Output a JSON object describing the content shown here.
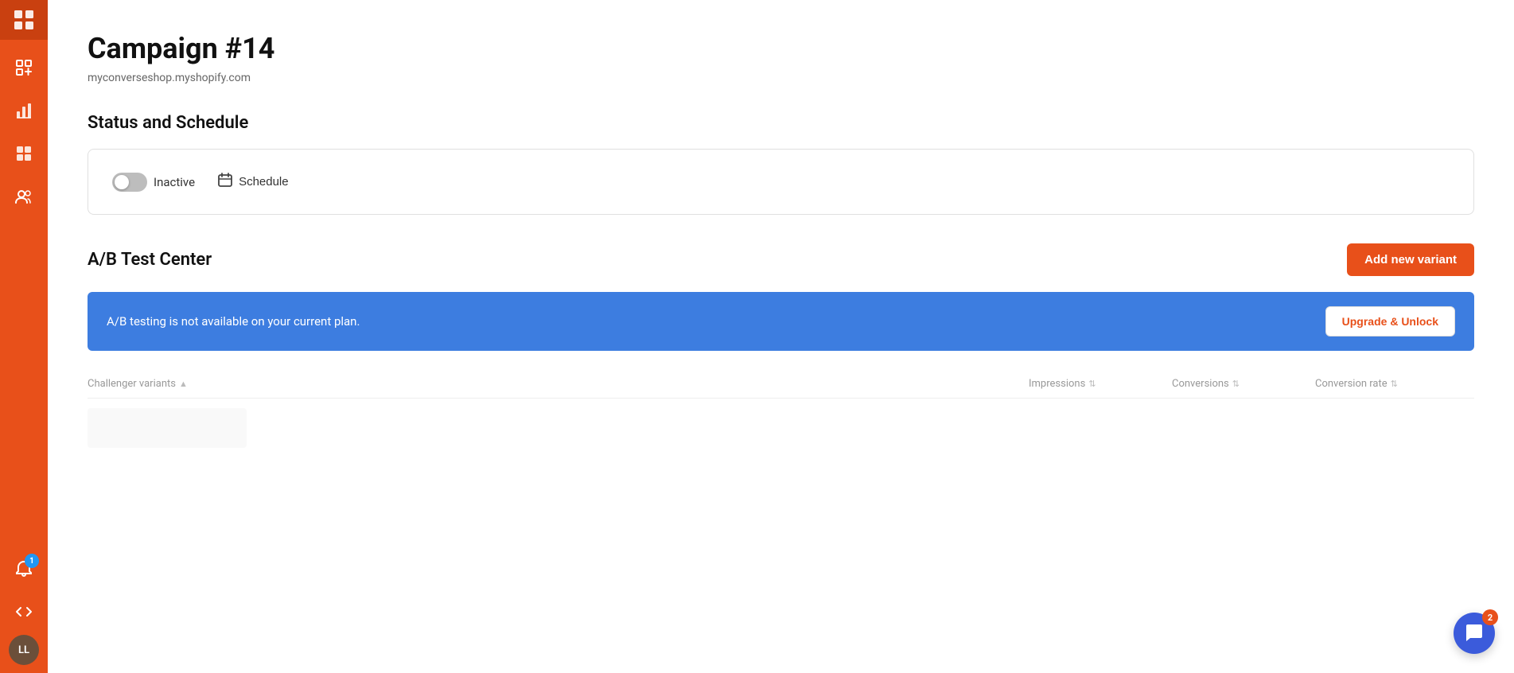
{
  "sidebar": {
    "logo_icon": "⊞",
    "items": [
      {
        "id": "dashboard",
        "icon": "📊",
        "label": "Dashboard"
      },
      {
        "id": "grid",
        "icon": "⊞",
        "label": "Grid"
      },
      {
        "id": "users",
        "icon": "👥",
        "label": "Users"
      }
    ],
    "bottom_items": [
      {
        "id": "bell",
        "icon": "🔔",
        "label": "Notifications",
        "badge": "1"
      },
      {
        "id": "code",
        "icon": "</>",
        "label": "Code"
      },
      {
        "id": "avatar",
        "label": "LL",
        "badge": ""
      }
    ]
  },
  "page": {
    "title": "Campaign #14",
    "subtitle": "myconverseshop.myshopify.com"
  },
  "status_section": {
    "title": "Status and Schedule",
    "toggle_label": "Inactive",
    "schedule_label": "Schedule"
  },
  "ab_section": {
    "title": "A/B Test Center",
    "add_button_label": "Add new variant",
    "banner_text": "A/B testing is not available on your current plan.",
    "upgrade_button_label": "Upgrade & Unlock",
    "columns": [
      {
        "id": "challengers",
        "label": "Challenger variants"
      },
      {
        "id": "impressions",
        "label": "Impressions"
      },
      {
        "id": "conversions",
        "label": "Conversions"
      },
      {
        "id": "conversion_rate",
        "label": "Conversion rate"
      }
    ]
  },
  "chat_fab": {
    "badge": "2"
  }
}
